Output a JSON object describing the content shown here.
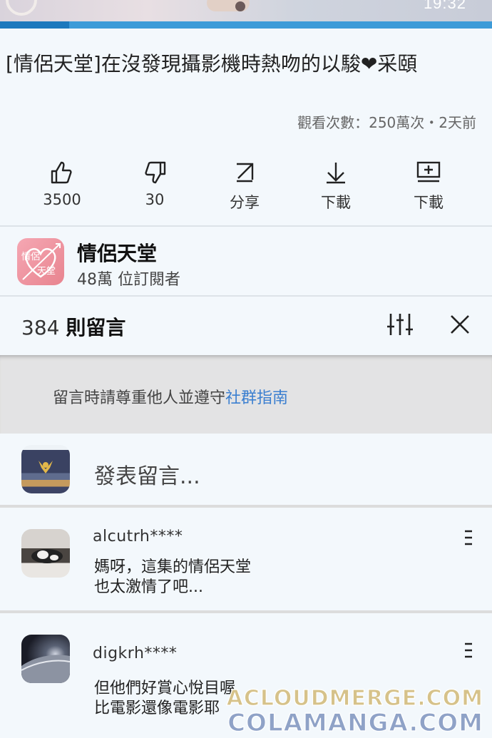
{
  "status_bar": {
    "time": "19:32"
  },
  "video": {
    "title": "[情侶天堂]在沒發現攝影機時熱吻的以駿❤采頤",
    "views_line": "觀看次數：250萬次・2天前",
    "progress": 0.14
  },
  "actions": [
    {
      "icon": "thumbs-up-icon",
      "label": "3500"
    },
    {
      "icon": "thumbs-down-icon",
      "label": "30"
    },
    {
      "icon": "share-icon",
      "label": "分享"
    },
    {
      "icon": "download-icon",
      "label": "下載"
    },
    {
      "icon": "save-to-playlist-icon",
      "label": "下載"
    }
  ],
  "channel": {
    "name": "情侶天堂",
    "subscribers": "48萬 位訂閱者",
    "logo_text_top": "情侶",
    "logo_text_bottom": "天堂"
  },
  "comments_header": {
    "count": "384",
    "label": "則留言"
  },
  "guidelines": {
    "text": "留言時請尊重他人並遵守",
    "link": "社群指南"
  },
  "composer": {
    "placeholder": "發表留言..."
  },
  "comments": [
    {
      "user": "alcutrh****",
      "lines": [
        "媽呀，這集的情侶天堂",
        "也太激情了吧..."
      ]
    },
    {
      "user": "digkrh****",
      "lines": [
        "但他們好賞心悅目喔",
        "比電影還像電影耶"
      ]
    }
  ],
  "watermarks": [
    "ACLOUDMERGE.COM",
    "COLAMANGA.COM"
  ],
  "colors": {
    "accent": "#3b7fd0",
    "progress": "#3d9bd8",
    "logo": "#e8848f"
  }
}
